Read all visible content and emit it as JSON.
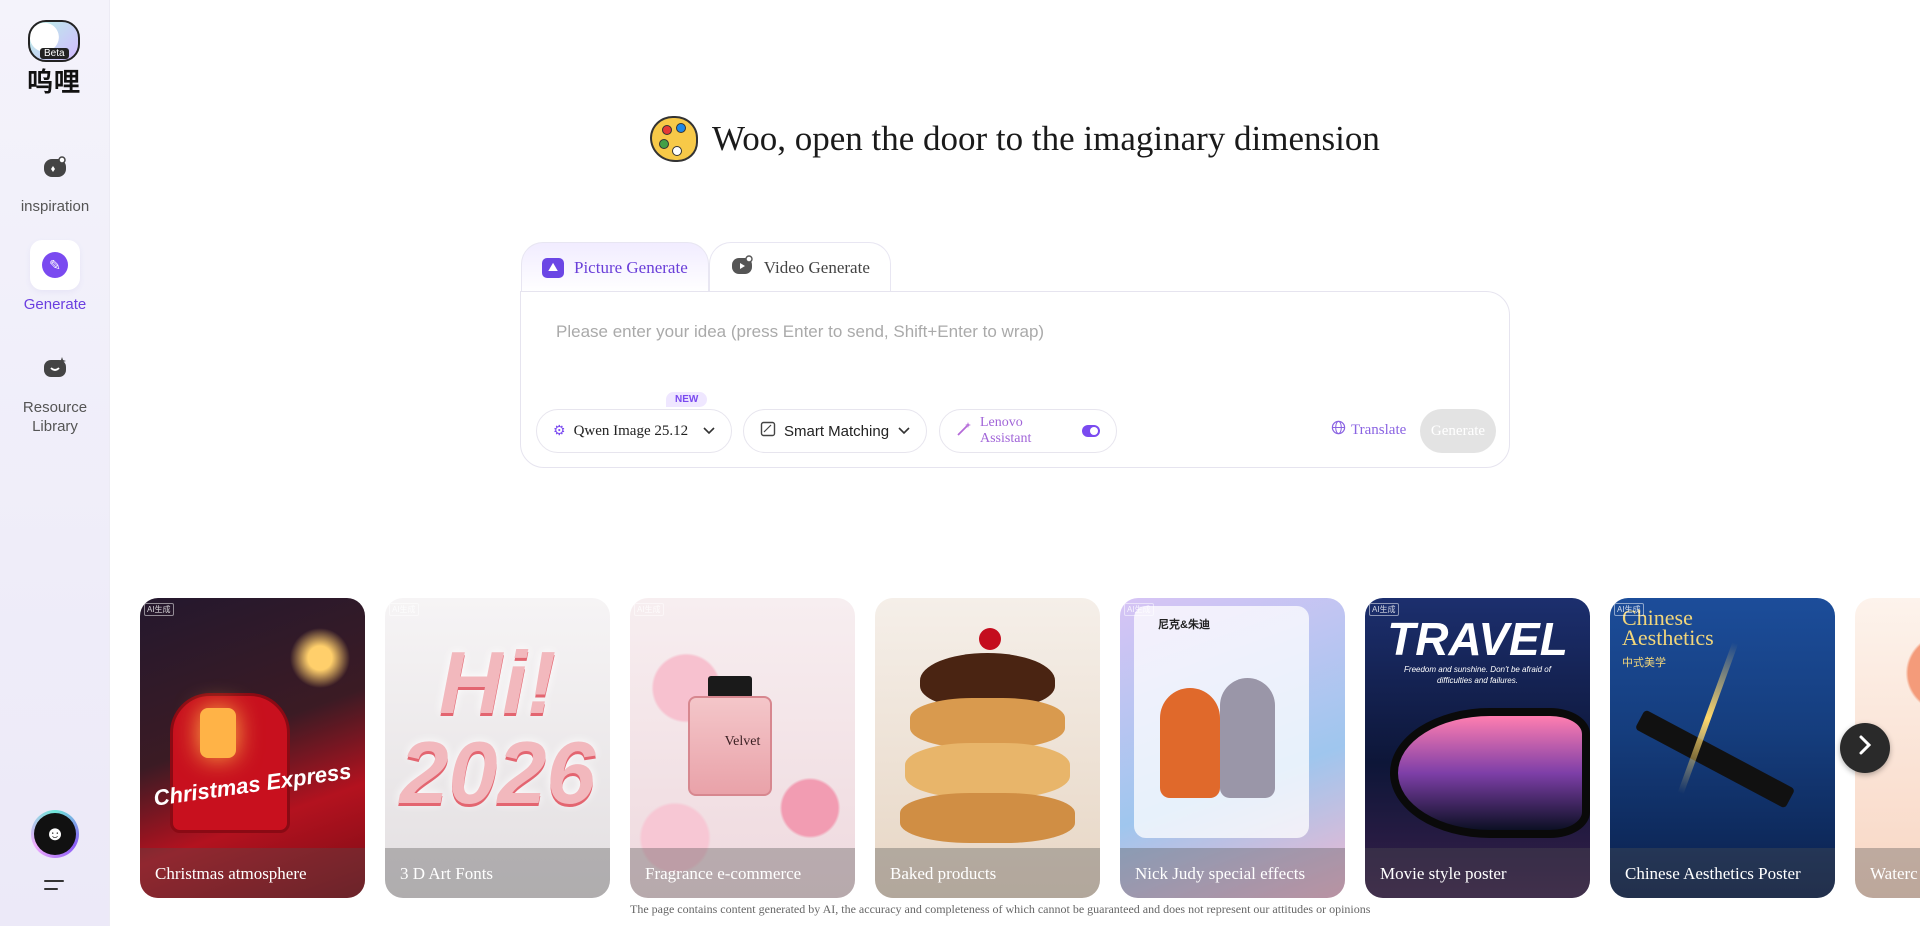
{
  "brand": {
    "logo_text": "呜哩",
    "badge": "Beta"
  },
  "sidebar": {
    "items": [
      {
        "label": "inspiration",
        "icon": "inspiration-icon",
        "active": false
      },
      {
        "label": "Generate",
        "icon": "generate-icon",
        "active": true
      },
      {
        "label": "Resource Library",
        "icon": "resource-library-icon",
        "active": false
      }
    ]
  },
  "headline": "Woo, open the door to the imaginary dimension",
  "composer": {
    "tabs": [
      {
        "label": "Picture Generate",
        "icon": "picture-icon",
        "active": true
      },
      {
        "label": "Video Generate",
        "icon": "video-icon",
        "active": false
      }
    ],
    "placeholder": "Please enter your idea (press Enter to send, Shift+Enter to wrap)",
    "value": "",
    "model": {
      "label": "Qwen Image 25.12",
      "badge": "NEW"
    },
    "ratio": {
      "label": "Smart Matching"
    },
    "assistant": {
      "label": "Lenovo Assistant",
      "enabled": true
    },
    "translate_label": "Translate",
    "generate_label": "Generate"
  },
  "gallery": {
    "cards": [
      {
        "caption": "Christmas atmosphere",
        "art_text": "Christmas Express",
        "colors": [
          "#2a1a2e",
          "#b3121f"
        ]
      },
      {
        "caption": "3 D Art Fonts",
        "art_text": "Hi! 2026",
        "colors": [
          "#f3f1f2",
          "#e5e0e2"
        ]
      },
      {
        "caption": "Fragrance e-commerce",
        "art_text": "Velvet",
        "colors": [
          "#f6e7ea",
          "#f2c9d3"
        ]
      },
      {
        "caption": "Baked products",
        "art_text": "",
        "colors": [
          "#f3ece6",
          "#d59b54"
        ]
      },
      {
        "caption": "Nick Judy special effects",
        "art_text": "尼克&朱迪",
        "colors": [
          "#c9b7f0",
          "#7fb9e8"
        ]
      },
      {
        "caption": "Movie style poster",
        "art_text": "TRAVEL",
        "sub_text": "Freedom and sunshine. Don't be afraid of difficulties and failures.",
        "colors": [
          "#1c2f6e",
          "#0d1638"
        ]
      },
      {
        "caption": "Chinese Aesthetics Poster",
        "art_text": "Chinese Aesthetics",
        "sub_text": "中式美学",
        "colors": [
          "#1c4d9a",
          "#0a1f4a"
        ]
      },
      {
        "caption": "Waterc",
        "art_text": "",
        "colors": [
          "#fdeee6",
          "#f7c2a8"
        ]
      }
    ],
    "ai_tag": "AI生成",
    "next_icon": "chevron-right-icon"
  },
  "disclaimer": "The page contains content generated by AI, the accuracy and completeness of which cannot be guaranteed and does not represent our attitudes or opinions"
}
